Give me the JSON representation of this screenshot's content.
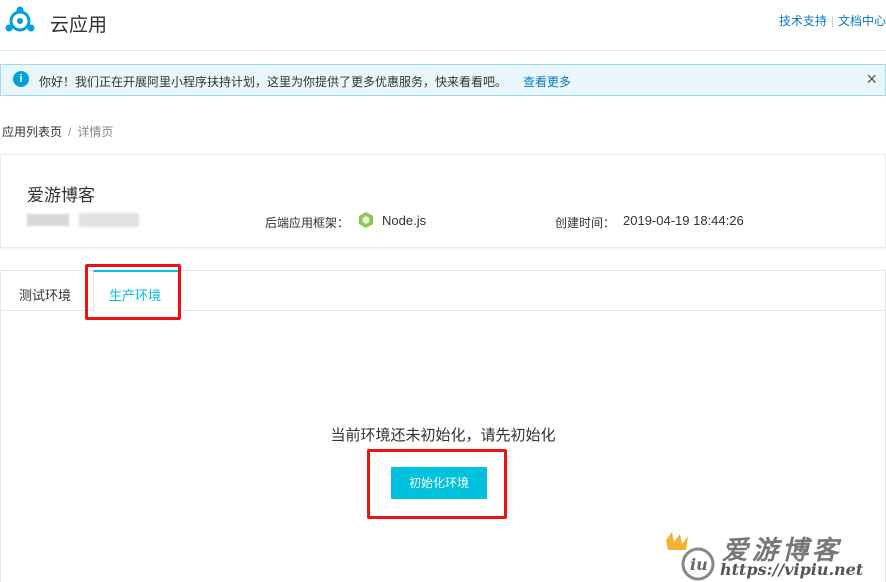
{
  "header": {
    "app_title": "云应用",
    "links": [
      "技术支持",
      "文档中心"
    ]
  },
  "notice": {
    "message": "你好！我们正在开展阿里小程序扶持计划，这里为你提供了更多优惠服务，快来看看吧。",
    "more_link": "查看更多",
    "close": "×"
  },
  "breadcrumb": {
    "parent": "应用列表页",
    "separator": "/",
    "current": "详情页"
  },
  "app_info": {
    "name": "爱游博客",
    "framework_label": "后端应用框架：",
    "framework_value": "Node.js",
    "created_label": "创建时间：",
    "created_value": "2019-04-19 18:44:26"
  },
  "tabs": [
    {
      "label": "测试环境",
      "active": false
    },
    {
      "label": "生产环境",
      "active": true
    }
  ],
  "empty_state": {
    "message": "当前环境还未初始化，请先初始化",
    "button_label": "初始化环境"
  },
  "watermark": {
    "text": "爱游博客",
    "url": "https://vipiu.net"
  },
  "colors": {
    "accent": "#00c1de",
    "link": "#0a7ac8",
    "annotation_red": "#e11111"
  }
}
